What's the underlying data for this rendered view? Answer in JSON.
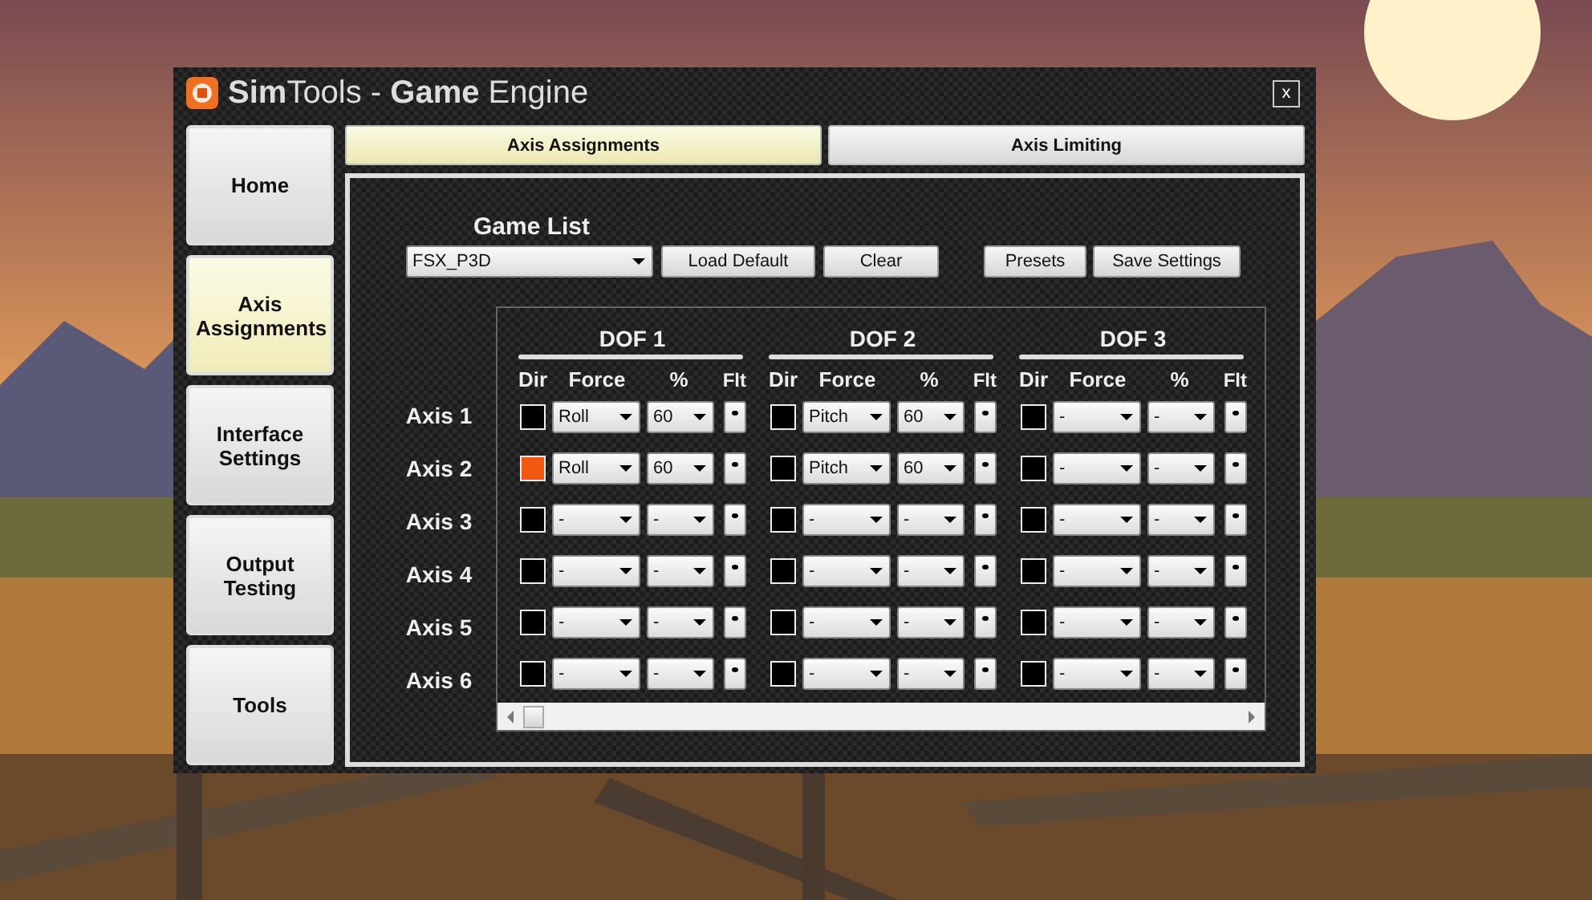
{
  "window": {
    "title": "**Sim**Tools - **Game** Engine",
    "close": "x"
  },
  "sidebar": {
    "items": [
      {
        "label": "Home",
        "selected": false
      },
      {
        "label": "Axis Assignments",
        "selected": true
      },
      {
        "label": "Interface Settings",
        "selected": false
      },
      {
        "label": "Output Testing",
        "selected": false
      },
      {
        "label": "Tools",
        "selected": false
      }
    ]
  },
  "tabs": [
    {
      "label": "Axis Assignments",
      "selected": true
    },
    {
      "label": "Axis Limiting",
      "selected": false
    }
  ],
  "game_list": {
    "label": "Game List",
    "value": "FSX_P3D"
  },
  "buttons": [
    "Load Default",
    "Clear",
    "Presets",
    "Save Settings"
  ],
  "dofs": [
    {
      "title": "DOF 1",
      "columns": [
        "Dir",
        "Force",
        "%",
        "Flt"
      ]
    },
    {
      "title": "DOF 2",
      "columns": [
        "Dir",
        "Force",
        "%",
        "Flt"
      ]
    },
    {
      "title": "DOF 3",
      "columns": [
        "Dir",
        "Force",
        "%",
        "Flt"
      ]
    }
  ],
  "axes": [
    {
      "label": "Axis 1",
      "cells": [
        {
          "dir": false,
          "force": "Roll",
          "percent": "60"
        },
        {
          "dir": false,
          "force": "Pitch",
          "percent": "60"
        },
        {
          "dir": false,
          "force": "-",
          "percent": "-"
        }
      ]
    },
    {
      "label": "Axis 2",
      "cells": [
        {
          "dir": true,
          "force": "Roll",
          "percent": "60"
        },
        {
          "dir": false,
          "force": "Pitch",
          "percent": "60"
        },
        {
          "dir": false,
          "force": "-",
          "percent": "-"
        }
      ]
    },
    {
      "label": "Axis 3",
      "cells": [
        {
          "dir": false,
          "force": "-",
          "percent": "-"
        },
        {
          "dir": false,
          "force": "-",
          "percent": "-"
        },
        {
          "dir": false,
          "force": "-",
          "percent": "-"
        }
      ]
    },
    {
      "label": "Axis 4",
      "cells": [
        {
          "dir": false,
          "force": "-",
          "percent": "-"
        },
        {
          "dir": false,
          "force": "-",
          "percent": "-"
        },
        {
          "dir": false,
          "force": "-",
          "percent": "-"
        }
      ]
    },
    {
      "label": "Axis 5",
      "cells": [
        {
          "dir": false,
          "force": "-",
          "percent": "-"
        },
        {
          "dir": false,
          "force": "-",
          "percent": "-"
        },
        {
          "dir": false,
          "force": "-",
          "percent": "-"
        }
      ]
    },
    {
      "label": "Axis 6",
      "cells": [
        {
          "dir": false,
          "force": "-",
          "percent": "-"
        },
        {
          "dir": false,
          "force": "-",
          "percent": "-"
        },
        {
          "dir": false,
          "force": "-",
          "percent": "-"
        }
      ]
    }
  ]
}
